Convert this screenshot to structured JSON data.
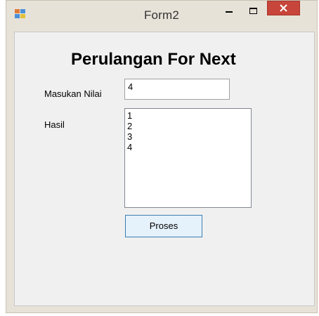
{
  "window": {
    "title": "Form2",
    "controls": {
      "minimize_icon": "minimize-icon",
      "maximize_icon": "maximize-icon",
      "close_icon": "close-icon",
      "close_color": "#c7453a"
    }
  },
  "form": {
    "heading": "Perulangan For Next",
    "input_label": "Masukan Nilai",
    "input_value": "4",
    "result_label": "Hasil",
    "results": [
      "1",
      "2",
      "3",
      "4"
    ],
    "button_label": "Proses"
  }
}
